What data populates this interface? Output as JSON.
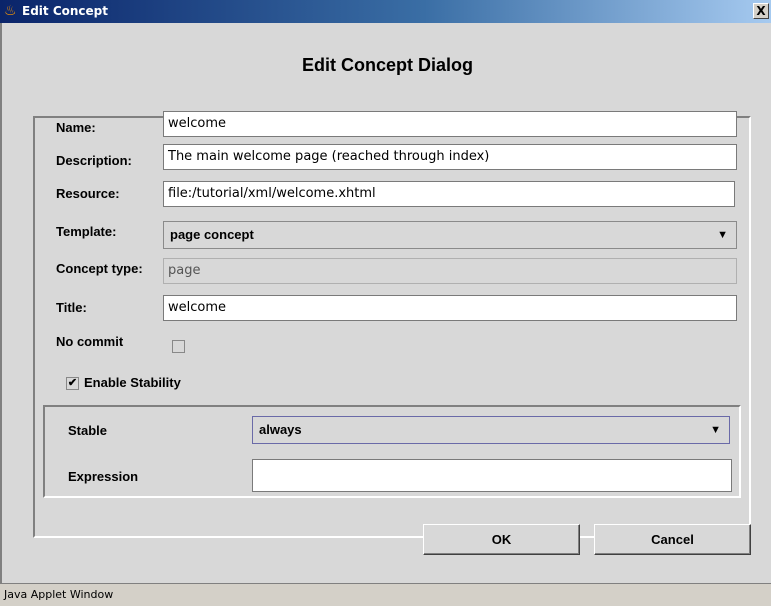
{
  "window": {
    "title": "Edit Concept",
    "title_icon": "java-cup-icon",
    "close_glyph": "X"
  },
  "dialog": {
    "heading": "Edit Concept Dialog",
    "fields": {
      "name": {
        "label": "Name:",
        "value": "welcome"
      },
      "description": {
        "label": "Description:",
        "value": "The main welcome page (reached through index)"
      },
      "resource": {
        "label": "Resource:",
        "value": "file:/tutorial/xml/welcome.xhtml"
      },
      "template": {
        "label": "Template:",
        "value": "page concept"
      },
      "concept_type": {
        "label": "Concept type:",
        "value": "page"
      },
      "title": {
        "label": "Title:",
        "value": "welcome"
      },
      "no_commit": {
        "label": "No commit",
        "checked": false
      }
    },
    "enable_stability": {
      "label": "Enable Stability",
      "checked": true,
      "check_glyph": "✔"
    },
    "stability": {
      "stable_label": "Stable",
      "stable_value": "always",
      "expression_label": "Expression",
      "expression_value": ""
    },
    "combo_arrow": "▼",
    "buttons": {
      "ok": "OK",
      "cancel": "Cancel"
    }
  },
  "statusbar": {
    "text": "Java Applet Window"
  },
  "colors": {
    "titlebar_start": "#0a246a",
    "titlebar_end": "#a6caf0",
    "dialog_bg": "#d8d8d8"
  }
}
